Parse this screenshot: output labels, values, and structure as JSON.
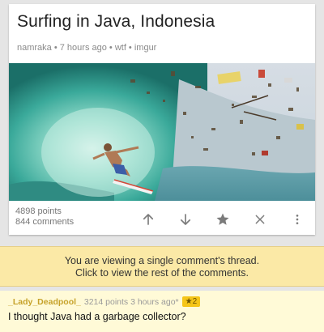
{
  "post": {
    "title": "Surfing in Java, Indonesia",
    "meta": "namraka • 7 hours ago • wtf • imgur",
    "image_alt": "surfer in a wave full of garbage",
    "points": "4898 points",
    "comments": "844 comments"
  },
  "actions": {
    "icons": [
      "upvote-icon",
      "downvote-icon",
      "star-icon",
      "hide-icon",
      "more-icon"
    ]
  },
  "banner": {
    "line1": "You are viewing a single comment's thread.",
    "line2": "Click to view the rest of the comments."
  },
  "comment": {
    "author": "_Lady_Deadpool_",
    "meta": "3214 points 3 hours ago*",
    "gilded": "★2",
    "body": "I thought Java had a garbage collector?"
  },
  "colors": {
    "banner_bg": "#fbe9a6",
    "comment_bg": "#fffad7",
    "author": "#c6a22a",
    "gold": "#f5c518"
  }
}
